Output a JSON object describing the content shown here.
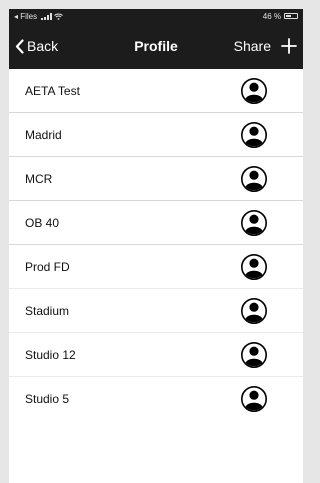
{
  "status_bar": {
    "back_app": "◂ Files",
    "battery": "46 %",
    "battery_level": 0.46
  },
  "nav": {
    "back_label": "Back",
    "title": "Profile",
    "share_label": "Share",
    "add_icon": "plus-icon"
  },
  "profiles": [
    {
      "label": "AETA Test",
      "icon": "user-circle-icon"
    },
    {
      "label": "Madrid",
      "icon": "user-circle-icon"
    },
    {
      "label": "MCR",
      "icon": "user-circle-icon"
    },
    {
      "label": "OB 40",
      "icon": "user-circle-icon"
    },
    {
      "label": "Prod FD",
      "icon": "user-circle-icon"
    },
    {
      "label": "Stadium",
      "icon": "user-circle-icon"
    },
    {
      "label": "Studio 12",
      "icon": "user-circle-icon"
    },
    {
      "label": "Studio 5",
      "icon": "user-circle-icon"
    }
  ],
  "colors": {
    "nav_background": "#1c1c1c",
    "nav_text": "#ffffff",
    "list_background": "#ffffff",
    "separator": "#d7d7d7",
    "outer_background": "#e6e6e6"
  }
}
